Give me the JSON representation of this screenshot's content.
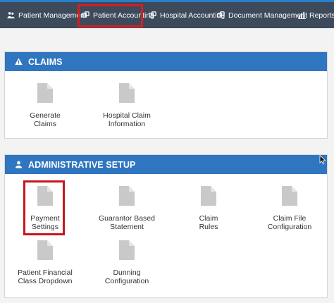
{
  "nav": {
    "items": [
      {
        "label": "Patient Management",
        "icon": "people-icon"
      },
      {
        "label": "Patient Accounting",
        "icon": "exchange-icon"
      },
      {
        "label": "Hospital Accounting",
        "icon": "exchange-icon"
      },
      {
        "label": "Document Management",
        "icon": "exchange-icon"
      },
      {
        "label": "Reports",
        "icon": "bar-chart-icon"
      }
    ],
    "highlighted": "Patient Accounting"
  },
  "claims": {
    "title": "CLAIMS",
    "icon": "warning-icon",
    "tiles": [
      {
        "label": "Generate\nClaims",
        "icon": "document-icon"
      },
      {
        "label": "Hospital Claim\nInformation",
        "icon": "document-icon"
      }
    ]
  },
  "admin": {
    "title": "ADMINISTRATIVE SETUP",
    "icon": "user-icon",
    "tiles": [
      {
        "label": "Payment\nSettings",
        "icon": "document-icon"
      },
      {
        "label": "Guarantor Based\nStatement",
        "icon": "document-icon"
      },
      {
        "label": "Claim\nRules",
        "icon": "document-icon"
      },
      {
        "label": "Claim File\nConfiguration",
        "icon": "document-icon"
      },
      {
        "label": "Patient Financial\nClass Dropdown",
        "icon": "document-icon"
      },
      {
        "label": "Dunning\nConfiguration",
        "icon": "document-icon"
      }
    ],
    "highlighted": "Payment Settings"
  },
  "colors": {
    "topbar": "#3d4a5c",
    "panel_header": "#2f75bf",
    "highlight": "#d42020",
    "doc_icon": "#c9c9c9"
  }
}
